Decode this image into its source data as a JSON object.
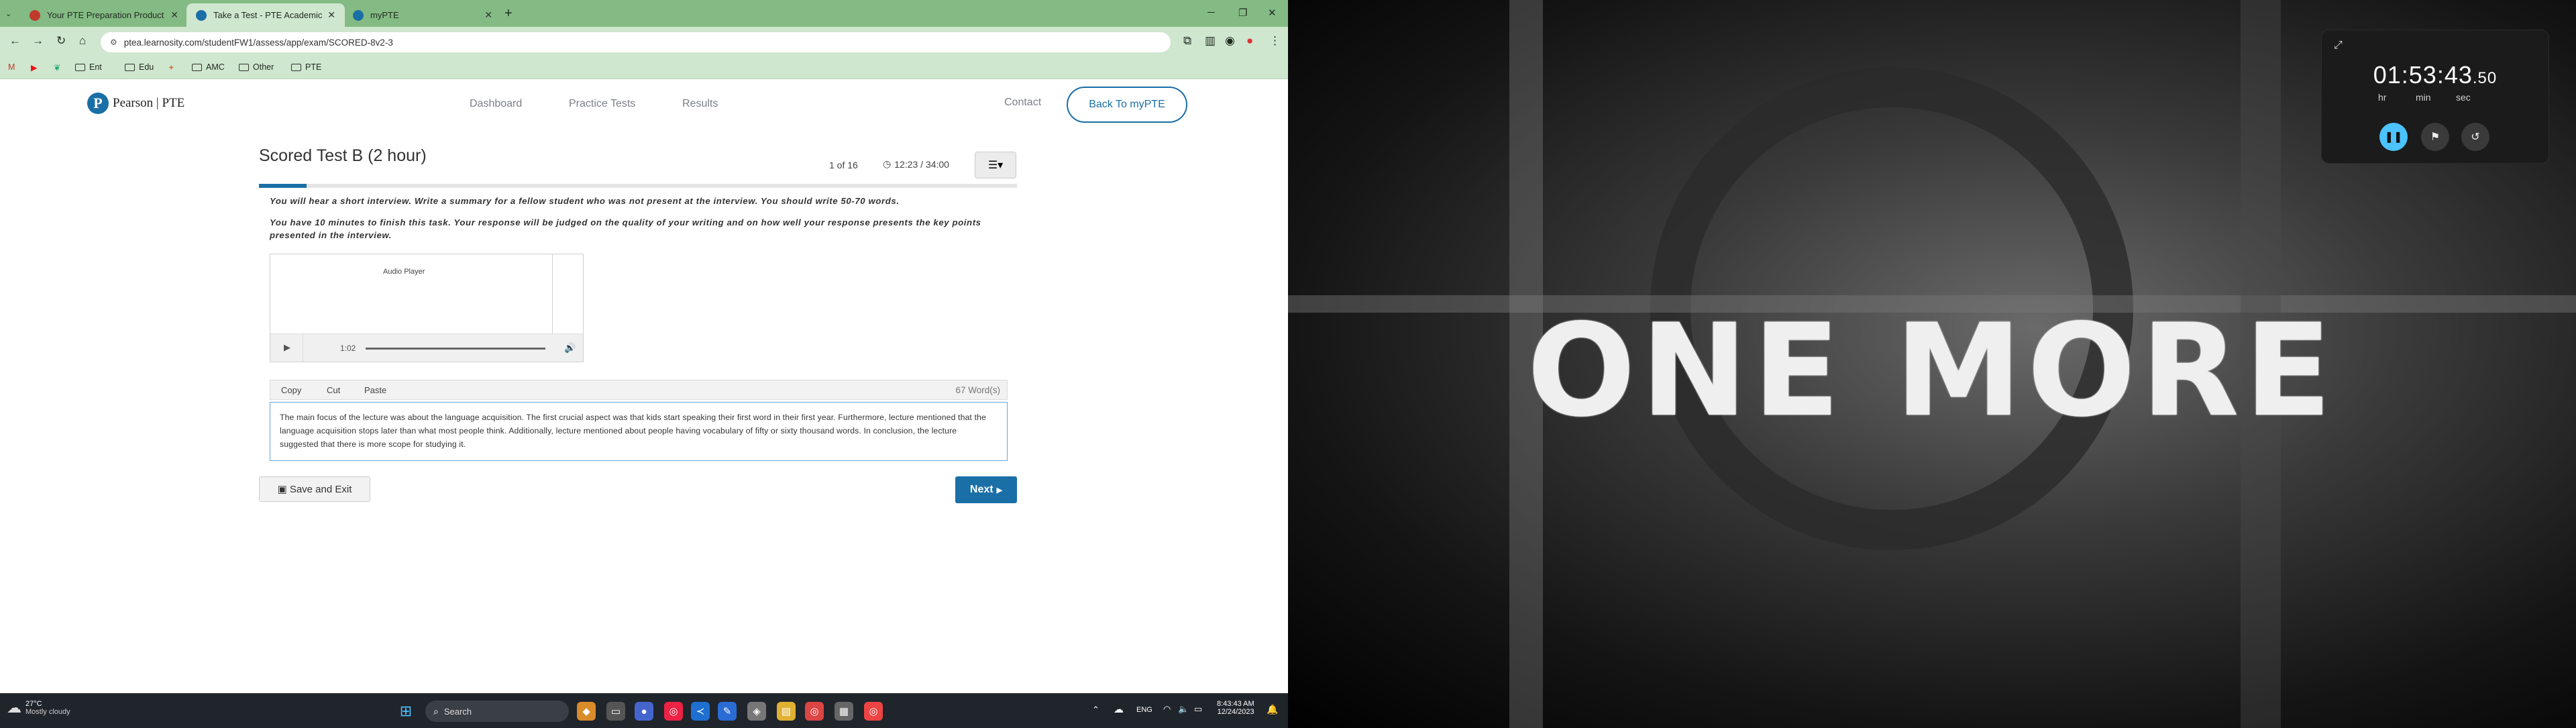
{
  "browser": {
    "tabs": [
      {
        "title": "Your PTE Preparation Product",
        "favicon_color": "#c0392b"
      },
      {
        "title": "Take a Test - PTE Academic",
        "favicon_color": "#1a6fa6"
      },
      {
        "title": "myPTE",
        "favicon_color": "#1a6fa6"
      }
    ],
    "url": "ptea.learnosity.com/studentFW1/assess/app/exam/SCORED-8v2-3",
    "bookmarks": [
      "Ent",
      "Edu",
      "AMC",
      "Other",
      "PTE"
    ]
  },
  "page": {
    "logo_text": "Pearson | PTE",
    "nav": {
      "dashboard": "Dashboard",
      "practice_tests": "Practice Tests",
      "results": "Results",
      "contact": "Contact"
    },
    "back_button": "Back To myPTE",
    "title": "Scored Test B (2 hour)",
    "counter": "1 of 16",
    "timer": "12:23 / 34:00",
    "progress_fraction": 0.0625,
    "instruction_1": "You will hear a short interview. Write a summary for a fellow student who was not present at the interview. You should write 50-70 words.",
    "instruction_2": "You have 10 minutes to finish this task. Your response will be judged on the quality of your writing and on how well your response presents the key points presented in the interview.",
    "player": {
      "label": "Audio Player",
      "time": "1:02"
    },
    "editor": {
      "copy": "Copy",
      "cut": "Cut",
      "paste": "Paste",
      "word_count": "67 Word(s)"
    },
    "answer": "The main focus of the lecture was about the language acquisition. The first crucial aspect was that kids start speaking their first word in their first year. Furthermore, lecture mentioned that the language acquisition stops later than what most people think. Additionally, lecture mentioned about people having vocabulary of fifty or sixty thousand words. In conclusion, the lecture suggested that there is more scope for studying it.",
    "save_exit": "Save and Exit",
    "next": "Next"
  },
  "taskbar": {
    "weather_temp": "27°C",
    "weather_desc": "Mostly cloudy",
    "search": "Search",
    "lang": "ENG",
    "time": "8:43:43 AM",
    "date": "12/24/2023"
  },
  "background_text": "ONE MORE",
  "stopwatch": {
    "time": "01:53:43",
    "ms": ".50",
    "unit_hr": "hr",
    "unit_min": "min",
    "unit_sec": "sec",
    "accent_color": "#4cc2ff"
  }
}
